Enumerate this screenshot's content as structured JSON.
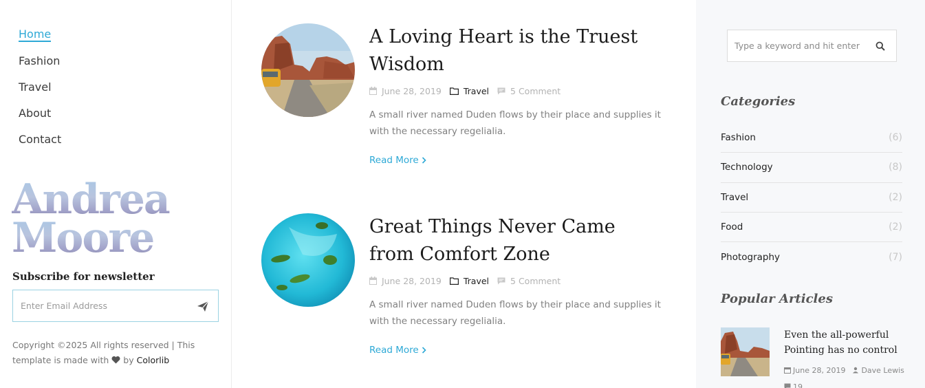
{
  "nav": {
    "items": [
      {
        "label": "Home",
        "active": true
      },
      {
        "label": "Fashion",
        "active": false
      },
      {
        "label": "Travel",
        "active": false
      },
      {
        "label": "About",
        "active": false
      },
      {
        "label": "Contact",
        "active": false
      }
    ]
  },
  "logo": {
    "line1": "Andrea",
    "line2": "Moore"
  },
  "newsletter": {
    "title": "Subscribe for newsletter",
    "placeholder": "Enter Email Address"
  },
  "footer": {
    "copyright_prefix": "Copyright ©2025 All rights reserved | This template is made with",
    "by": "by",
    "brand": "Colorlib"
  },
  "posts": [
    {
      "title": "A Loving Heart is the Truest Wisdom",
      "date": "June 28, 2019",
      "category": "Travel",
      "comments": "5 Comment",
      "excerpt": "A small river named Duden flows by their place and supplies it with the necessary regelialia.",
      "read_more": "Read More"
    },
    {
      "title": "Great Things Never Came from Comfort Zone",
      "date": "June 28, 2019",
      "category": "Travel",
      "comments": "5 Comment",
      "excerpt": "A small river named Duden flows by their place and supplies it with the necessary regelialia.",
      "read_more": "Read More"
    }
  ],
  "search": {
    "placeholder": "Type a keyword and hit enter"
  },
  "categories": {
    "title": "Categories",
    "items": [
      {
        "name": "Fashion",
        "count": "(6)"
      },
      {
        "name": "Technology",
        "count": "(8)"
      },
      {
        "name": "Travel",
        "count": "(2)"
      },
      {
        "name": "Food",
        "count": "(2)"
      },
      {
        "name": "Photography",
        "count": "(7)"
      }
    ]
  },
  "popular": {
    "title": "Popular Articles",
    "items": [
      {
        "title": "Even the all-powerful Pointing has no control",
        "date": "June 28, 2019",
        "author": "Dave Lewis",
        "comments": "19"
      }
    ]
  },
  "colors": {
    "accent": "#2ea9d6",
    "sidebar_bg": "#f7f8fa",
    "text_dark": "#1b1b1b",
    "muted": "#808080"
  }
}
